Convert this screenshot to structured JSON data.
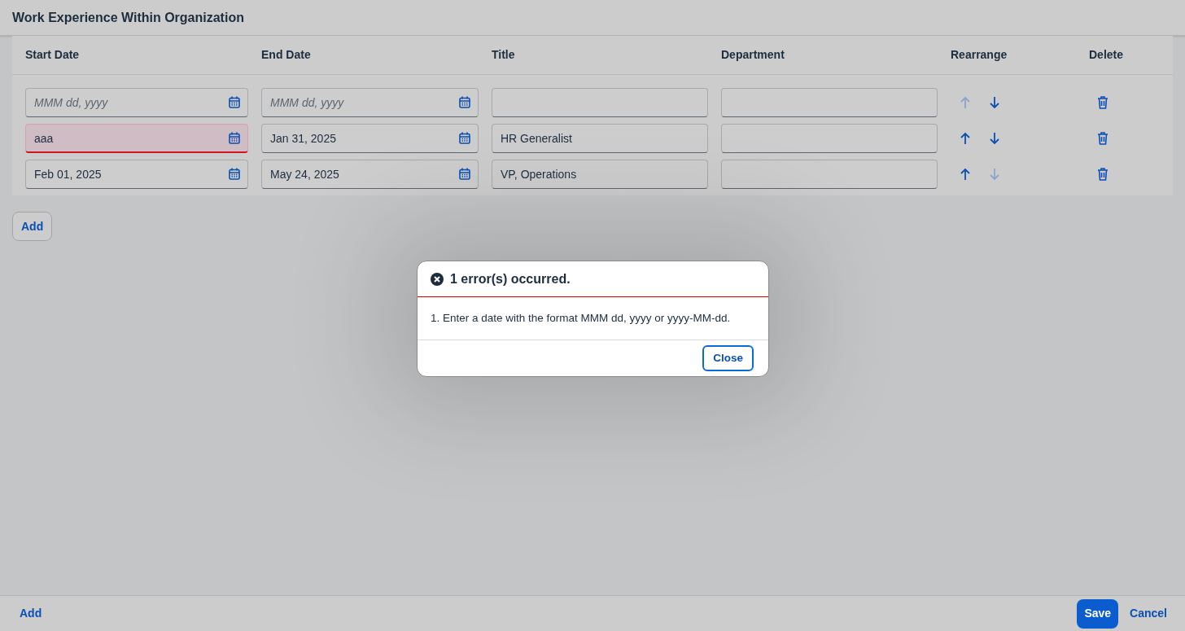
{
  "header": {
    "title": "Work Experience Within Organization"
  },
  "table": {
    "columns": [
      "Start Date",
      "End Date",
      "Title",
      "Department",
      "Rearrange",
      "Delete"
    ],
    "rows": [
      {
        "start_date": {
          "placeholder": "MMM dd, yyyy",
          "error": false
        },
        "end_date": {
          "placeholder": "MMM dd, yyyy",
          "error": false
        },
        "title": {},
        "department": {},
        "move_up_disabled": true,
        "move_down_disabled": false
      },
      {
        "start_date": {
          "value": "aaa",
          "error": true
        },
        "end_date": {
          "value": "Jan 31, 2025",
          "error": false
        },
        "title": {
          "value": "HR Generalist"
        },
        "department": {},
        "move_up_disabled": false,
        "move_down_disabled": false
      },
      {
        "start_date": {
          "value": "Feb 01, 2025",
          "error": false
        },
        "end_date": {
          "value": "May 24, 2025",
          "error": false
        },
        "title": {
          "value": "VP, Operations"
        },
        "department": {},
        "move_up_disabled": false,
        "move_down_disabled": true
      }
    ]
  },
  "add_button": "Add",
  "dialog": {
    "title": "1 error(s) occurred.",
    "messages": [
      "1. Enter a date with the format MMM dd, yyyy or yyyy-MM-dd."
    ],
    "close_button": "Close"
  },
  "footer": {
    "left_button": "Add",
    "save_button": "Save",
    "cancel_button": "Cancel"
  }
}
